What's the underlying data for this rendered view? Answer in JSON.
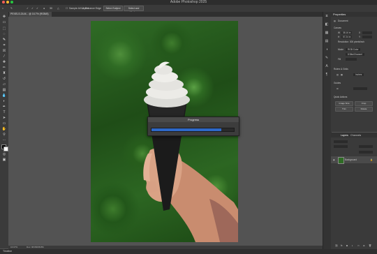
{
  "window": {
    "title": "Adobe Photoshop 2025"
  },
  "options_bar": {
    "size_value": "30",
    "sample_all_layers": "Sample All Layers",
    "enhance_edge": "Enhance Edge",
    "select_subject": "Select Subject",
    "select_and_mask": "Select and Mask..."
  },
  "document_tab": {
    "label": "PEXELS-OLM... @ 16.7% (RGB/8)"
  },
  "status_bar": {
    "zoom": "16.67%",
    "info": "Doc: 98.8M/98.8M"
  },
  "timeline": {
    "label": "Timeline"
  },
  "properties_panel": {
    "title": "Properties",
    "doc_label": "Document",
    "canvas_section": "Canvas",
    "w_label": "W",
    "w_value": "38.16 in",
    "h_label": "H",
    "h_value": "57.24 in",
    "x_label": "X",
    "y_label": "Y",
    "resolution_text": "Resolution: 300 pixels/inch",
    "mode_label": "Mode",
    "mode_value": "RGB Color",
    "bit_value": "8 Bits/Channel",
    "fill_label": "Fill",
    "rulers_section": "Rulers & Grids",
    "rulers_unit": "Inches",
    "guides_section": "Guides",
    "quick_actions_section": "Quick Actions",
    "image_size_btn": "Image Size",
    "crop_btn": "Crop",
    "trim_btn": "Trim",
    "rotate_btn": "Rotate"
  },
  "layers_panel": {
    "tab_layers": "Layers",
    "tab_channels": "Channels",
    "layer_name": "Background"
  },
  "progress_dialog": {
    "title": "Progress",
    "progress": 0.85
  },
  "colors": {
    "progress_fill": "#2e68c8",
    "panel_bg": "#3a3a3a"
  }
}
